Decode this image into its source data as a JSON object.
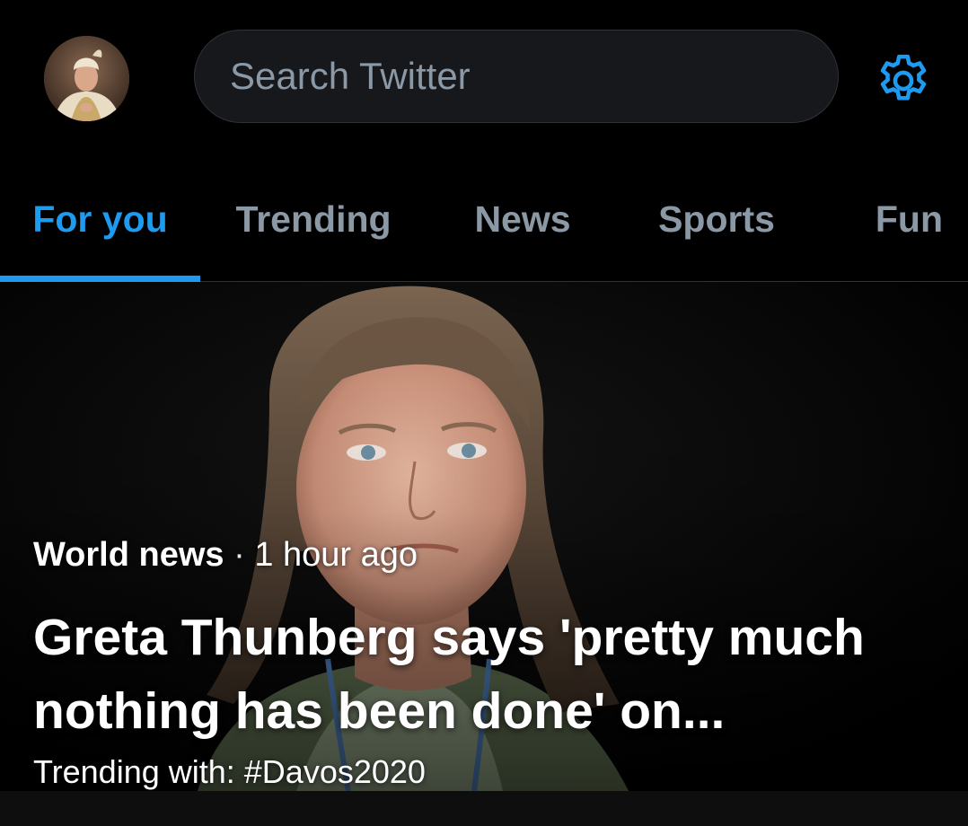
{
  "search": {
    "placeholder": "Search Twitter"
  },
  "icons": {
    "avatar": "profile-avatar",
    "settings": "gear-icon"
  },
  "tabs": [
    {
      "label": "For you",
      "active": true
    },
    {
      "label": "Trending",
      "active": false
    },
    {
      "label": "News",
      "active": false
    },
    {
      "label": "Sports",
      "active": false
    },
    {
      "label": "Fun",
      "active": false
    }
  ],
  "hero": {
    "category": "World news",
    "separator": "·",
    "time": "1 hour ago",
    "title": "Greta Thunberg says 'pretty much nothing has been done' on...",
    "trending": "Trending with: #Davos2020"
  },
  "colors": {
    "accent": "#1d9bf0",
    "background": "#000000",
    "muted_text": "#8b98a5",
    "border": "#2f3336"
  }
}
